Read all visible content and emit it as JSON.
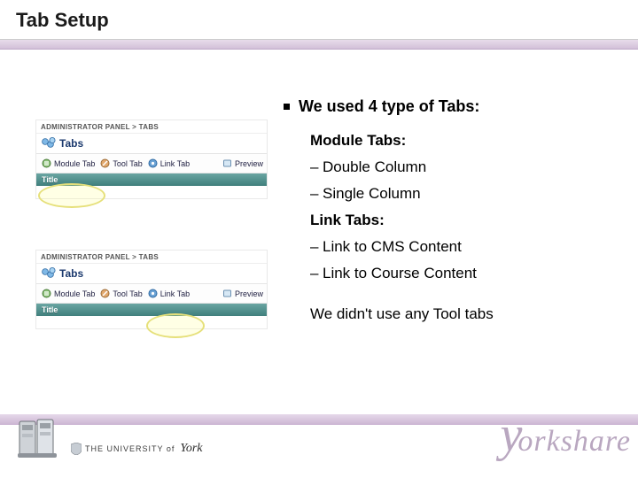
{
  "title": "Tab Setup",
  "content": {
    "bullet": "We used 4 type of Tabs:",
    "module_head": "Module Tabs:",
    "module_items": [
      "Double Column",
      "Single Column"
    ],
    "link_head": "Link Tabs:",
    "link_items": [
      "Link to CMS Content",
      "Link to Course Content"
    ],
    "note": "We didn't use any Tool tabs"
  },
  "panel": {
    "crumb": "ADMINISTRATOR PANEL > TABS",
    "heading": "Tabs",
    "items": [
      "Module Tab",
      "Tool Tab",
      "Link Tab"
    ],
    "preview": "Preview",
    "titlebar": "Title"
  },
  "footer": {
    "university_prefix": "THE UNIVERSITY of",
    "university_name": "York",
    "brand": "orkshare"
  }
}
